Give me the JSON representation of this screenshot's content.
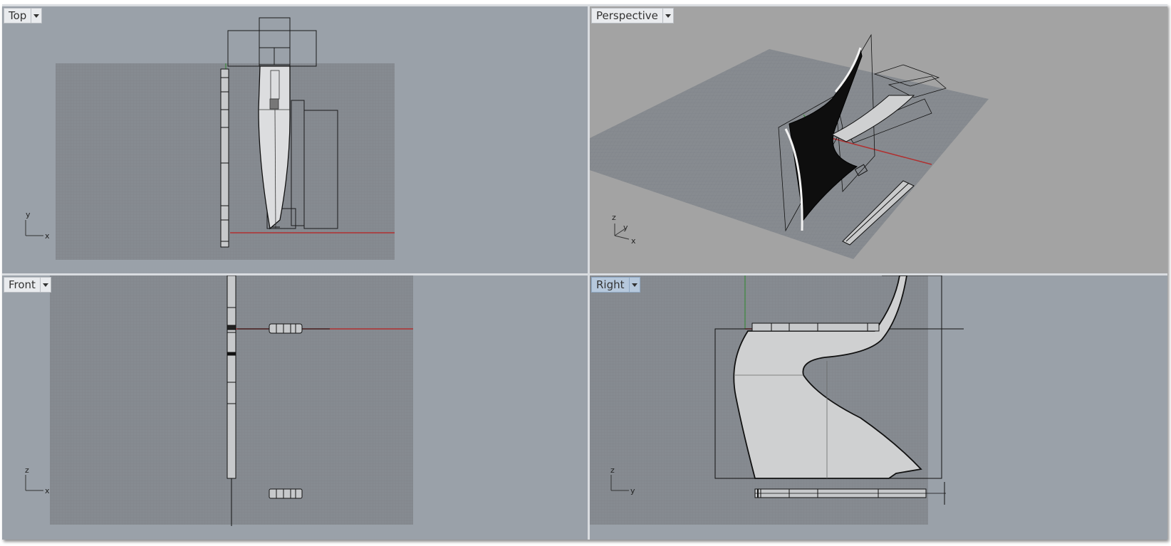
{
  "viewports": {
    "top": {
      "label": "Top",
      "axes": {
        "h": "x",
        "v": "y"
      }
    },
    "perspective": {
      "label": "Perspective",
      "axes": {
        "a": "z",
        "b": "y",
        "c": "x"
      }
    },
    "front": {
      "label": "Front",
      "axes": {
        "h": "x",
        "v": "z"
      }
    },
    "right": {
      "label": "Right",
      "axes": {
        "h": "y",
        "v": "z"
      }
    }
  },
  "active_viewport": "right",
  "icons": {
    "dropdown": "chevron-down-icon"
  },
  "colors": {
    "viewport_bg": "#9aa1a9",
    "perspective_bg": "#a3a3a3",
    "grid_plane": "#868b91",
    "x_axis": "#b03030",
    "y_axis": "#2c8a2c",
    "surface": "#cfd0d1",
    "active_tab": "#b6c8dc"
  }
}
